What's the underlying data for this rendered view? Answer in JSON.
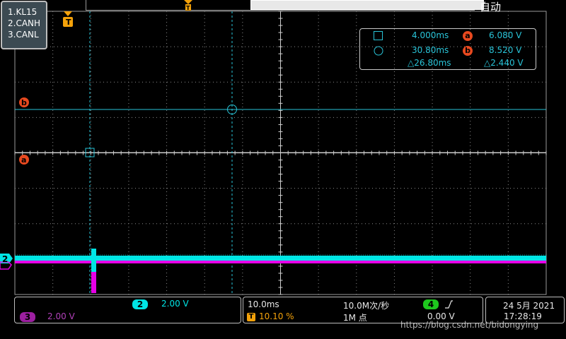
{
  "topbar": {
    "trigger_mode": "自动",
    "trigger_marker": "T"
  },
  "channel_labels": [
    "1.KL15",
    "2.CANH",
    "3.CANL"
  ],
  "cursors": {
    "a_time": "4.000ms",
    "a_value": "6.080 V",
    "b_time": "30.80ms",
    "b_value": "8.520 V",
    "delta_time": "△26.80ms",
    "delta_value": "△2.440 V",
    "a_marker": "a",
    "b_marker": "b"
  },
  "channel_marker": "2",
  "channels": {
    "ch2": {
      "badge": "2",
      "scale": "2.00 V"
    },
    "ch3": {
      "badge": "3",
      "scale": "2.00 V"
    }
  },
  "timebase": {
    "scale": "10.0ms",
    "trigger_badge": "T",
    "trigger_position": "10.10 %",
    "sample_rate": "10.0M次/秒",
    "memory_depth": "1M 点"
  },
  "trigger": {
    "source_badge": "4",
    "slope_icon": "rising-edge-icon",
    "level": "0.00 V"
  },
  "datetime": {
    "date": "24 5月 2021",
    "time": "17:28:19"
  },
  "watermark": "https://blog.csdn.net/bidongying",
  "colors": {
    "grid": "#bfbfbf",
    "cyan": "#00e5e5",
    "magenta": "#e600e6",
    "cursor_badge": "#e8491f",
    "trigger_orange": "#f4a20a",
    "ch4_green": "#1ec81e"
  }
}
